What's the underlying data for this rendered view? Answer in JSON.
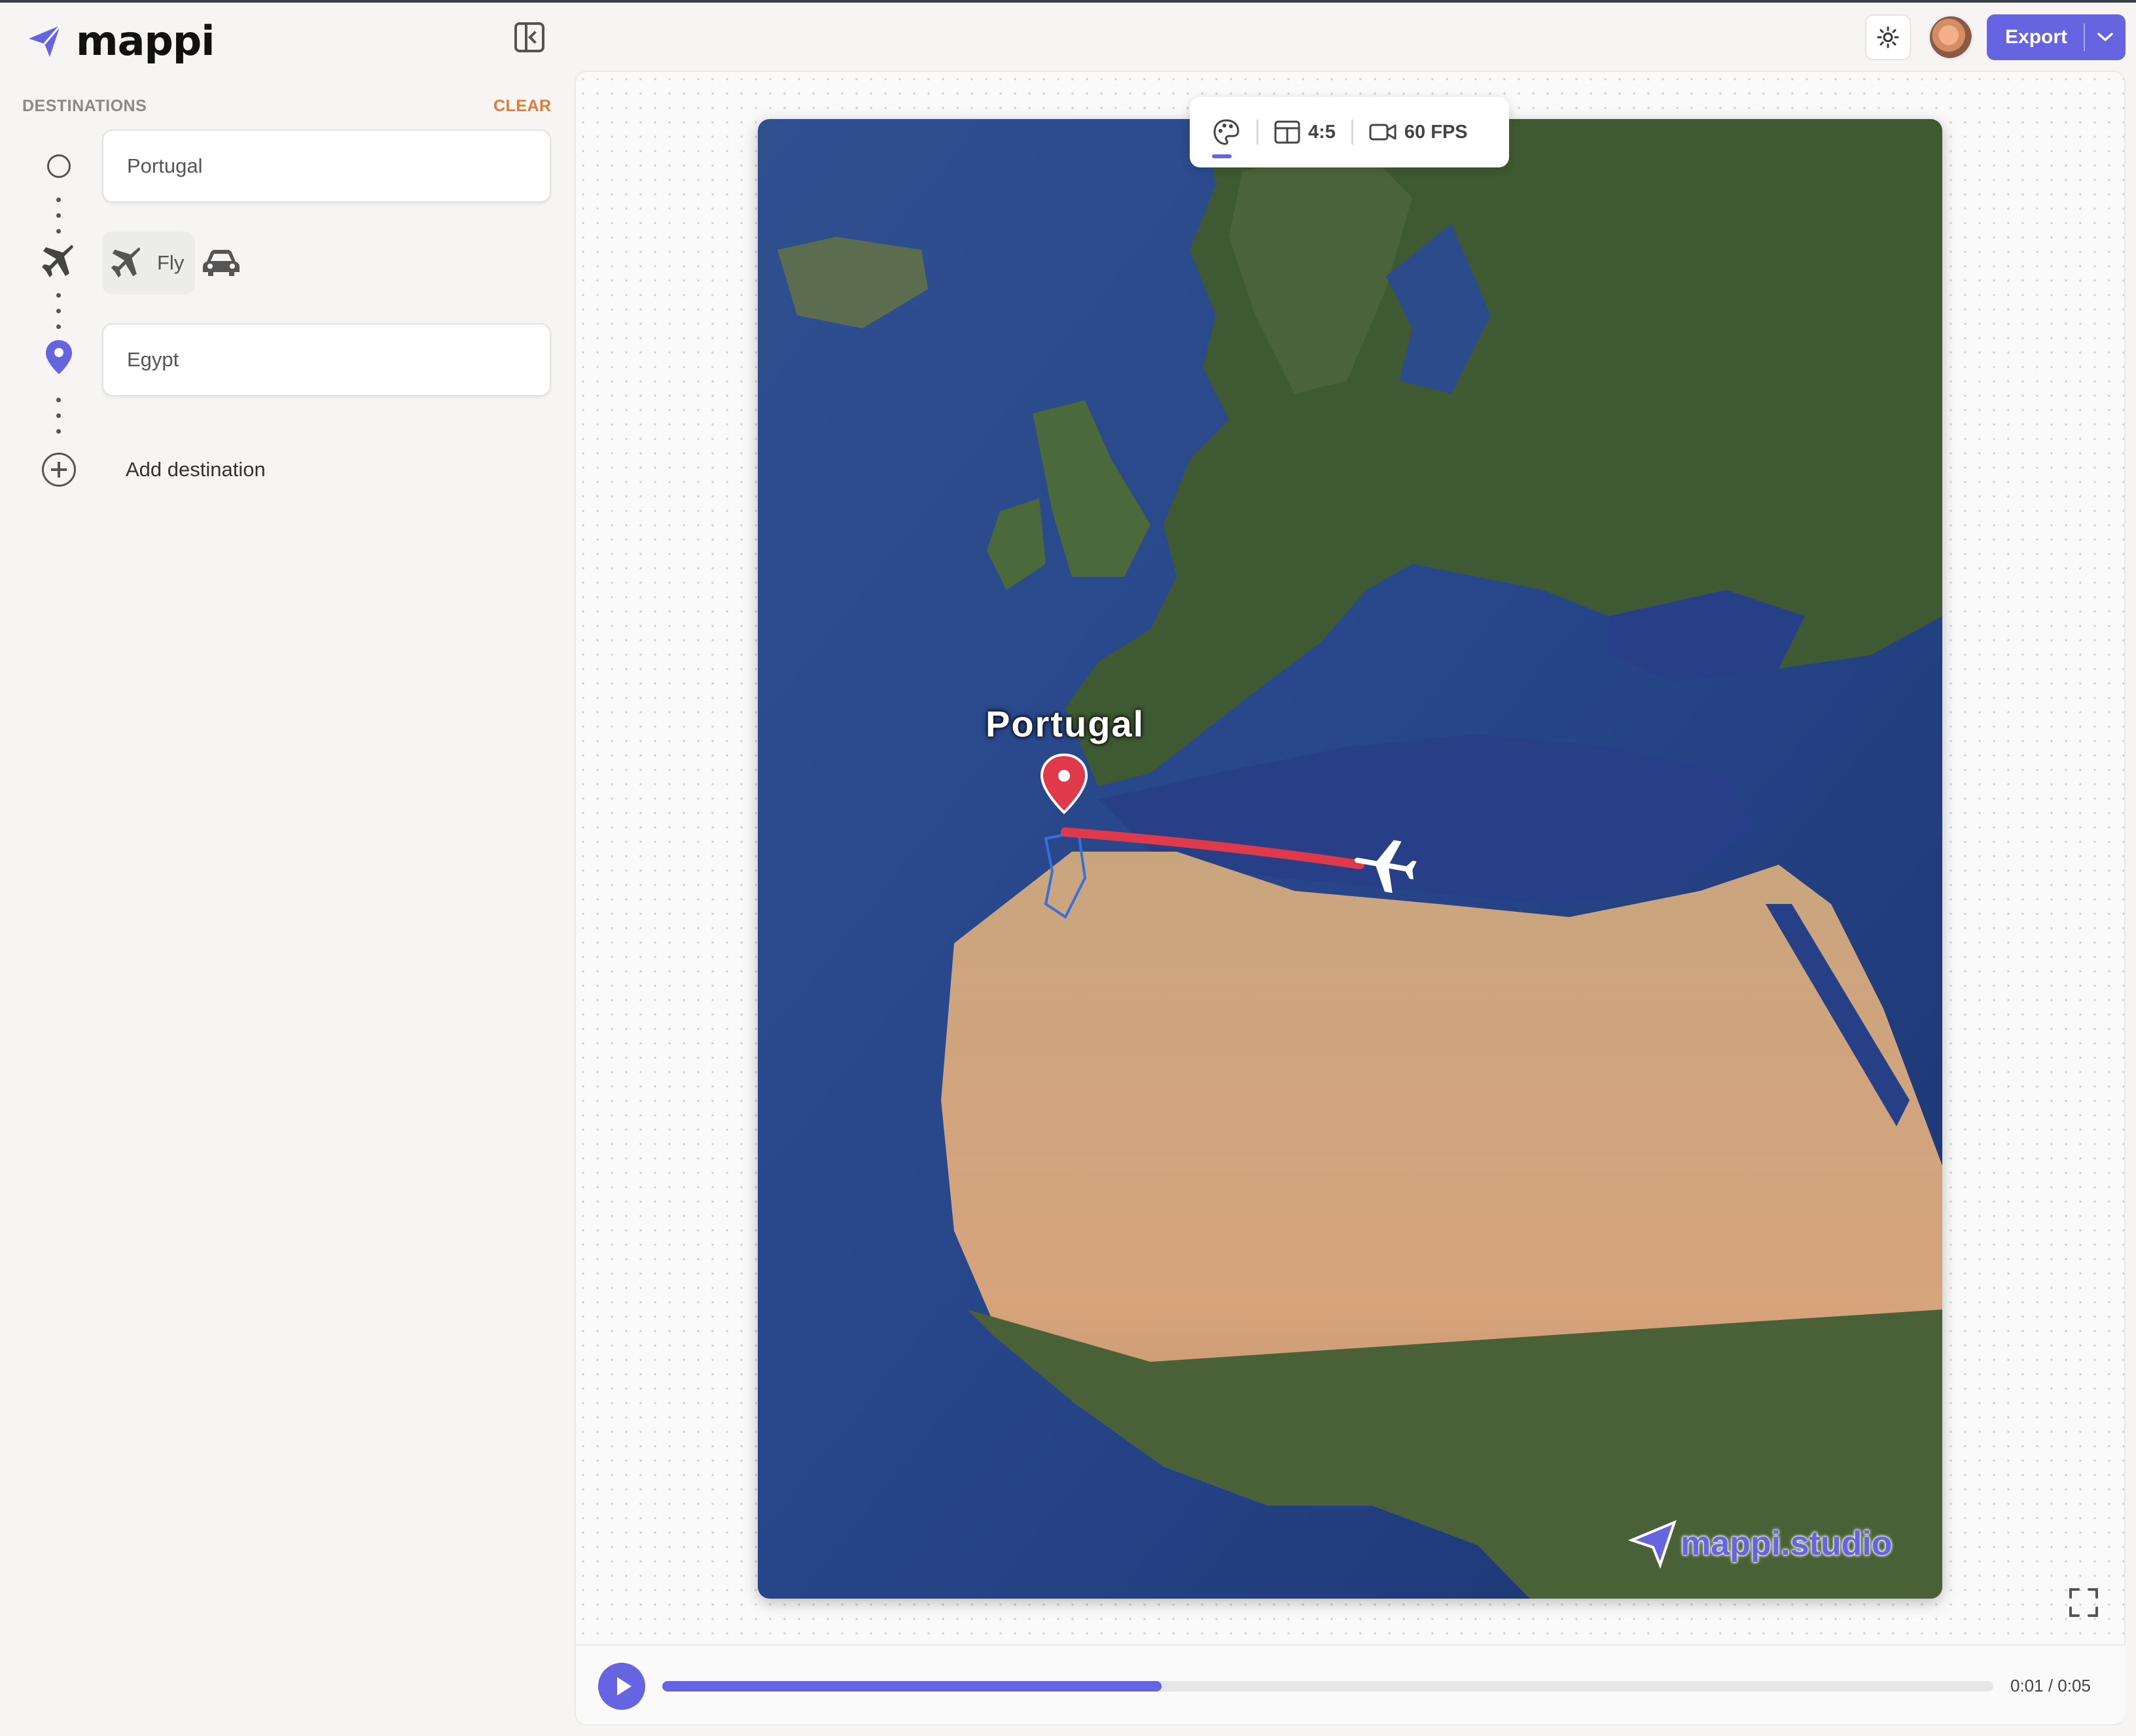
{
  "app": {
    "name": "mappi"
  },
  "header": {
    "collapse_icon": "sidebar-collapse-icon",
    "theme_icon": "sun-icon",
    "export_label": "Export"
  },
  "sidebar": {
    "section_label": "DESTINATIONS",
    "clear_label": "CLEAR",
    "origin": {
      "value": "Portugal",
      "icon": "circle-icon"
    },
    "transport": {
      "selected": "Fly",
      "options": [
        "Fly",
        "Drive"
      ],
      "icons": [
        "plane-icon",
        "car-icon"
      ]
    },
    "destination": {
      "value": "Egypt",
      "icon": "map-pin-icon"
    },
    "add_label": "Add destination"
  },
  "toolbar": {
    "style_icon": "palette-icon",
    "aspect_ratio": "4:5",
    "fps": "60 FPS"
  },
  "map": {
    "origin_label": "Portugal",
    "watermark": "mappi.studio",
    "route_color": "#e03a4a",
    "pin_color": "#e03a4a"
  },
  "playback": {
    "progress": 0.375,
    "time": "0:01 / 0:05"
  },
  "colors": {
    "accent": "#6664e0",
    "clear": "#e07b3a"
  }
}
